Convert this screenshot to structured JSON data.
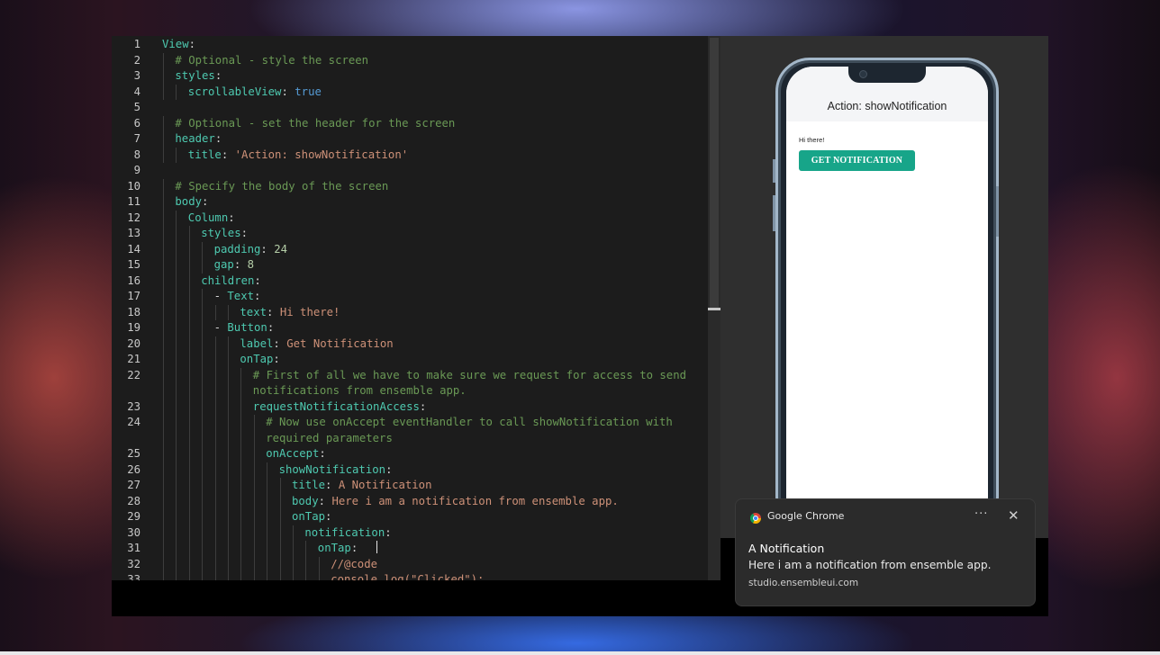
{
  "editor": {
    "lines": [
      {
        "n": "1",
        "indent": 0,
        "parts": [
          [
            "k",
            "View"
          ],
          [
            "p",
            ":"
          ]
        ]
      },
      {
        "n": "2",
        "indent": 1,
        "parts": [
          [
            "c",
            "# Optional - style the screen"
          ]
        ]
      },
      {
        "n": "3",
        "indent": 1,
        "parts": [
          [
            "k",
            "styles"
          ],
          [
            "p",
            ":"
          ]
        ]
      },
      {
        "n": "4",
        "indent": 2,
        "parts": [
          [
            "k",
            "scrollableView"
          ],
          [
            "p",
            ": "
          ],
          [
            "b",
            "true"
          ]
        ]
      },
      {
        "n": "5",
        "indent": 0,
        "parts": []
      },
      {
        "n": "6",
        "indent": 1,
        "parts": [
          [
            "c",
            "# Optional - set the header for the screen"
          ]
        ]
      },
      {
        "n": "7",
        "indent": 1,
        "parts": [
          [
            "k",
            "header"
          ],
          [
            "p",
            ":"
          ]
        ]
      },
      {
        "n": "8",
        "indent": 2,
        "parts": [
          [
            "k",
            "title"
          ],
          [
            "p",
            ": "
          ],
          [
            "s",
            "'Action: showNotification'"
          ]
        ]
      },
      {
        "n": "9",
        "indent": 0,
        "parts": []
      },
      {
        "n": "10",
        "indent": 1,
        "parts": [
          [
            "c",
            "# Specify the body of the screen"
          ]
        ]
      },
      {
        "n": "11",
        "indent": 1,
        "parts": [
          [
            "k",
            "body"
          ],
          [
            "p",
            ":"
          ]
        ]
      },
      {
        "n": "12",
        "indent": 2,
        "parts": [
          [
            "k",
            "Column"
          ],
          [
            "p",
            ":"
          ]
        ]
      },
      {
        "n": "13",
        "indent": 3,
        "parts": [
          [
            "k",
            "styles"
          ],
          [
            "p",
            ":"
          ]
        ]
      },
      {
        "n": "14",
        "indent": 4,
        "parts": [
          [
            "k",
            "padding"
          ],
          [
            "p",
            ": "
          ],
          [
            "n",
            "24"
          ]
        ]
      },
      {
        "n": "15",
        "indent": 4,
        "parts": [
          [
            "k",
            "gap"
          ],
          [
            "p",
            ": "
          ],
          [
            "n",
            "8"
          ]
        ]
      },
      {
        "n": "16",
        "indent": 3,
        "parts": [
          [
            "k",
            "children"
          ],
          [
            "p",
            ":"
          ]
        ]
      },
      {
        "n": "17",
        "indent": 4,
        "parts": [
          [
            "p",
            "- "
          ],
          [
            "k",
            "Text"
          ],
          [
            "p",
            ":"
          ]
        ]
      },
      {
        "n": "18",
        "indent": 6,
        "parts": [
          [
            "k",
            "text"
          ],
          [
            "p",
            ": "
          ],
          [
            "s",
            "Hi there!"
          ]
        ]
      },
      {
        "n": "19",
        "indent": 4,
        "parts": [
          [
            "p",
            "- "
          ],
          [
            "k",
            "Button"
          ],
          [
            "p",
            ":"
          ]
        ]
      },
      {
        "n": "20",
        "indent": 6,
        "parts": [
          [
            "k",
            "label"
          ],
          [
            "p",
            ": "
          ],
          [
            "s",
            "Get Notification"
          ]
        ]
      },
      {
        "n": "21",
        "indent": 6,
        "parts": [
          [
            "k",
            "onTap"
          ],
          [
            "p",
            ":"
          ]
        ]
      },
      {
        "n": "22",
        "indent": 7,
        "parts": [
          [
            "c",
            "# First of all we have to make sure we request for access to send"
          ]
        ]
      },
      {
        "n": "",
        "indent": 7,
        "parts": [
          [
            "c",
            "notifications from ensemble app."
          ]
        ]
      },
      {
        "n": "23",
        "indent": 7,
        "parts": [
          [
            "k",
            "requestNotificationAccess"
          ],
          [
            "p",
            ":"
          ]
        ]
      },
      {
        "n": "24",
        "indent": 8,
        "parts": [
          [
            "c",
            "# Now use onAccept eventHandler to call showNotification with"
          ]
        ]
      },
      {
        "n": "",
        "indent": 8,
        "parts": [
          [
            "c",
            "required parameters"
          ]
        ]
      },
      {
        "n": "25",
        "indent": 8,
        "parts": [
          [
            "k",
            "onAccept"
          ],
          [
            "p",
            ":"
          ]
        ]
      },
      {
        "n": "26",
        "indent": 9,
        "parts": [
          [
            "k",
            "showNotification"
          ],
          [
            "p",
            ":"
          ]
        ]
      },
      {
        "n": "27",
        "indent": 10,
        "parts": [
          [
            "k",
            "title"
          ],
          [
            "p",
            ": "
          ],
          [
            "s",
            "A Notification"
          ]
        ]
      },
      {
        "n": "28",
        "indent": 10,
        "parts": [
          [
            "k",
            "body"
          ],
          [
            "p",
            ": "
          ],
          [
            "s",
            "Here i am a notification from ensemble app."
          ]
        ]
      },
      {
        "n": "29",
        "indent": 10,
        "parts": [
          [
            "k",
            "onTap"
          ],
          [
            "p",
            ":"
          ]
        ]
      },
      {
        "n": "30",
        "indent": 11,
        "parts": [
          [
            "k",
            "notification"
          ],
          [
            "p",
            ":"
          ]
        ]
      },
      {
        "n": "31",
        "indent": 12,
        "parts": [
          [
            "k",
            "onTap"
          ],
          [
            "p",
            ":  "
          ]
        ],
        "cursor": true
      },
      {
        "n": "32",
        "indent": 13,
        "parts": [
          [
            "s",
            "//@code"
          ]
        ]
      },
      {
        "n": "33",
        "indent": 13,
        "parts": [
          [
            "s",
            "console.log(\"Clicked\");"
          ]
        ]
      }
    ]
  },
  "preview": {
    "header_title": "Action: showNotification",
    "text": "Hi there!",
    "button_label": "GET NOTIFICATION"
  },
  "notification": {
    "app_name": "Google Chrome",
    "more": "···",
    "close": "✕",
    "title": "A Notification",
    "body": "Here i am a notification from ensemble app.",
    "site": "studio.ensembleui.com"
  },
  "icons": {
    "chrome": "chrome-icon",
    "more": "more-options-icon",
    "close": "close-icon"
  }
}
